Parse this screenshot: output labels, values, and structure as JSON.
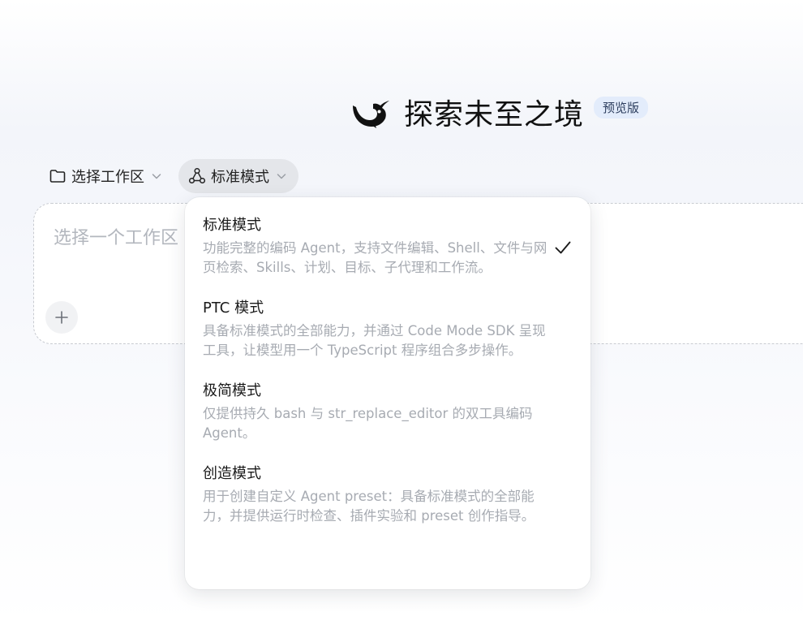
{
  "header": {
    "title": "探索未至之境",
    "badge": "预览版",
    "logo_icon": "whale-logo-icon"
  },
  "toolbar": {
    "workspace_label": "选择工作区",
    "workspace_icon": "folder-icon",
    "mode_label": "标准模式",
    "mode_icon": "triangle-nodes-icon"
  },
  "composer": {
    "placeholder": "选择一个工作区",
    "add_icon": "plus-icon"
  },
  "dropdown": {
    "selected": "标准模式",
    "options": [
      {
        "label": "标准模式",
        "description": "功能完整的编码 Agent，支持文件编辑、Shell、文件与网页检索、Skills、计划、目标、子代理和工作流。",
        "selected": true
      },
      {
        "label": "PTC 模式",
        "description": "具备标准模式的全部能力，并通过 Code Mode SDK 呈现工具，让模型用一个 TypeScript 程序组合多步操作。",
        "selected": false
      },
      {
        "label": "极简模式",
        "description": "仅提供持久 bash 与 str_replace_editor 的双工具编码 Agent。",
        "selected": false
      },
      {
        "label": "创造模式",
        "description": "用于创建自定义 Agent preset：具备标准模式的全部能力，并提供运行时检查、插件实验和 preset 创作指导。",
        "selected": false
      }
    ]
  },
  "colors": {
    "badge_bg": "#e3ecfb",
    "active_button_bg": "#e4e6ea",
    "description_text": "#a7abb2"
  }
}
